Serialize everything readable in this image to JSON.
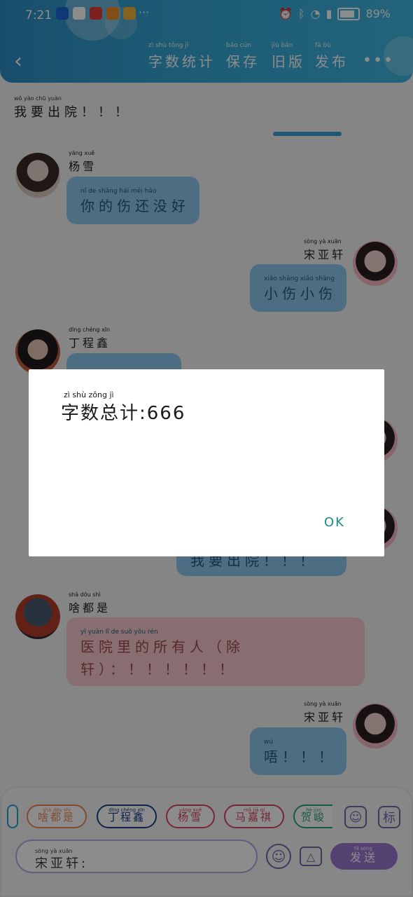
{
  "status": {
    "time": "7:21",
    "battery": "89%"
  },
  "header": {
    "back_icon": "chevron-left-icon",
    "actions": [
      {
        "label": "字数统计",
        "pinyin": "zì shù tǒng jì"
      },
      {
        "label": "保存",
        "pinyin": "bǎo cún"
      },
      {
        "label": "旧版",
        "pinyin": "jiù bǎn"
      },
      {
        "label": "发布",
        "pinyin": "fā bù"
      }
    ],
    "more_icon": "more-icon"
  },
  "chat": {
    "top_line": {
      "text": "我要出院！！！",
      "pinyin": "wǒ yào chū yuàn"
    },
    "messages": [
      {
        "side": "left",
        "name": "杨雪",
        "name_pinyin": "yáng xuě",
        "text": "你的伤还没好",
        "pinyin": "nǐ de shāng hái méi hǎo"
      },
      {
        "side": "right",
        "name": "宋亚轩",
        "name_pinyin": "sòng yà xuān",
        "text": "小伤小伤",
        "pinyin": "xiǎo shāng xiǎo shāng"
      },
      {
        "side": "left",
        "name": "丁程鑫",
        "name_pinyin": "dīng chéng xīn"
      },
      {
        "side": "right",
        "text": "我要出院！！！"
      },
      {
        "side": "left",
        "name": "啥都是",
        "name_pinyin": "shà dōu shì",
        "text_line1": "医院里的所有人（除",
        "text_line2": "轩）：！！！！！！",
        "pinyin": "yī yuàn lǐ de suǒ yǒu rén"
      },
      {
        "side": "right",
        "name": "宋亚轩",
        "name_pinyin": "sòng yà xuān",
        "text": "唔！！！",
        "pinyin": "wú"
      }
    ]
  },
  "bottom": {
    "chips": [
      {
        "label": "啥都是",
        "pinyin": "shà dōu shì",
        "color": "#e88a5a"
      },
      {
        "label": "丁程鑫",
        "pinyin": "dīng chéng xīn",
        "color": "#1b3e8a"
      },
      {
        "label": "杨雪",
        "pinyin": "yáng xuě",
        "color": "#d6455f"
      },
      {
        "label": "马嘉祺",
        "pinyin": "mǎ jiā qí",
        "color": "#d6455f"
      },
      {
        "label": "贺峻",
        "pinyin": "hè jùn",
        "color": "#2aa37a"
      }
    ],
    "person_icon": "person-icon",
    "tag_label": "标",
    "input_label": "宋亚轩:",
    "input_pinyin": "sòng yà xuān",
    "emoji_icon": "emoji-icon",
    "image_icon": "image-icon",
    "send_label": "发送",
    "send_pinyin": "fā sòng"
  },
  "dialog": {
    "text": "字数总计:666",
    "pinyin": "zì shù zǒng jì",
    "ok": "OK"
  }
}
